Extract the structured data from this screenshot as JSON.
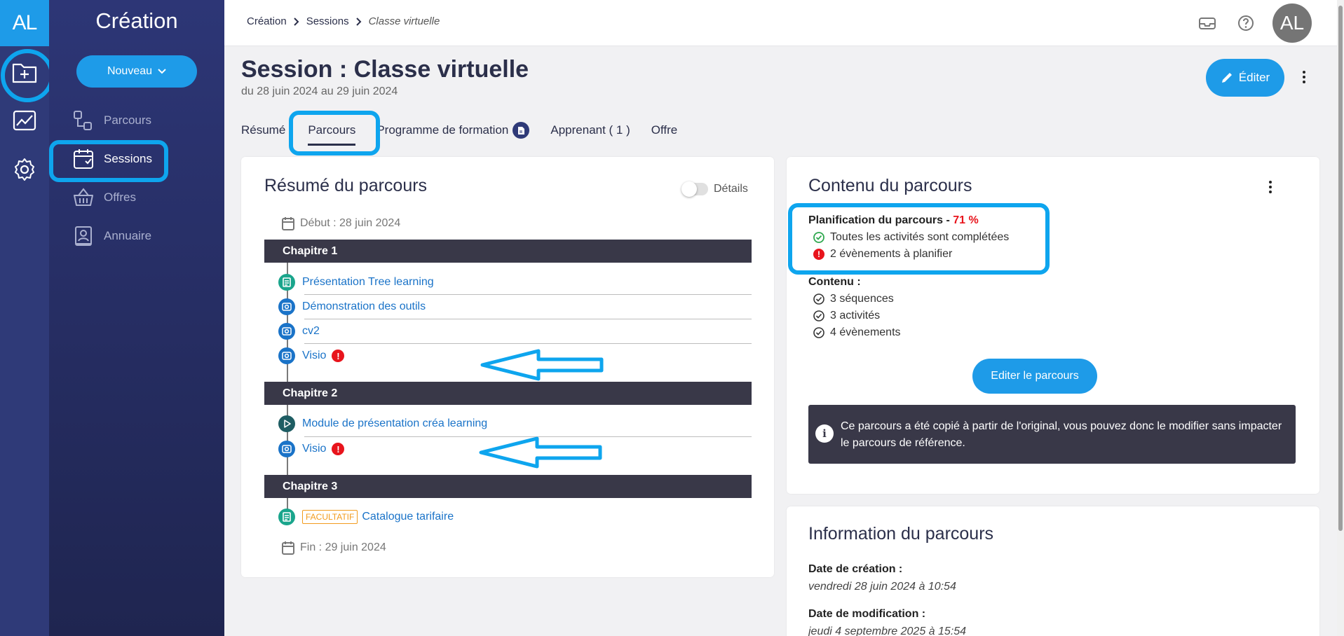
{
  "app": {
    "logo": "AL",
    "section_title": "Création",
    "new_button": "Nouveau"
  },
  "sidebar": {
    "items": [
      {
        "label": "Parcours",
        "icon": "path-icon"
      },
      {
        "label": "Sessions",
        "icon": "calendar-icon",
        "active": true
      },
      {
        "label": "Offres",
        "icon": "basket-icon"
      },
      {
        "label": "Annuaire",
        "icon": "contact-book-icon"
      }
    ]
  },
  "breadcrumb": [
    "Création",
    "Sessions",
    "Classe virtuelle"
  ],
  "user": {
    "initials": "AL"
  },
  "session": {
    "title": "Session : Classe virtuelle",
    "dates": "du 28 juin 2024 au 29 juin 2024",
    "edit_label": "Éditer"
  },
  "tabs": [
    {
      "label": "Résumé"
    },
    {
      "label": "Parcours",
      "active": true
    },
    {
      "label": "Programme de formation"
    },
    {
      "label": "Apprenant ( 1 )"
    },
    {
      "label": "Offre"
    }
  ],
  "summary": {
    "title": "Résumé du parcours",
    "details_toggle": "Détails",
    "start": "Début : 28 juin 2024",
    "end": "Fin : 29 juin 2024",
    "chapters": [
      {
        "name": "Chapitre 1",
        "activities": [
          {
            "label": "Présentation Tree learning",
            "type": "document"
          },
          {
            "label": "Démonstration des outils",
            "type": "visio"
          },
          {
            "label": "cv2",
            "type": "visio"
          },
          {
            "label": "Visio",
            "type": "visio",
            "warning": "!"
          }
        ]
      },
      {
        "name": "Chapitre 2",
        "activities": [
          {
            "label": "Module de présentation créa learning",
            "type": "module"
          },
          {
            "label": "Visio",
            "type": "visio",
            "warning": "!"
          }
        ]
      },
      {
        "name": "Chapitre 3",
        "activities": [
          {
            "label": "Catalogue tarifaire",
            "type": "document",
            "tag": "FACULTATIF"
          }
        ]
      }
    ]
  },
  "content": {
    "title": "Contenu du parcours",
    "planning_label": "Planification du parcours - ",
    "planning_pct": "71 %",
    "planning_ok": "Toutes les activités sont complétées",
    "planning_warn": "2 évènements à planifier",
    "warn_mark": "!",
    "contenu_label": "Contenu :",
    "contenu_items": [
      "3 séquences",
      "3 activités",
      "4 évènements"
    ],
    "edit_button": "Editer le parcours",
    "info_mark": "i",
    "info_text": "Ce parcours a été copié à partir de l'original, vous pouvez donc le modifier sans impacter le parcours de référence."
  },
  "information": {
    "title": "Information du parcours",
    "created_label": "Date de création :",
    "created_value": "vendredi 28 juin 2024 à 10:54",
    "modified_label": "Date de modification :",
    "modified_value": "jeudi 4 septembre 2025 à 15:54"
  },
  "colors": {
    "accent": "#1e9be8",
    "highlight": "#0ea5ee",
    "sidebar": "#2d3676",
    "chapter_bar": "#393848",
    "warning": "#e8141c",
    "optional": "#f29b1d"
  }
}
